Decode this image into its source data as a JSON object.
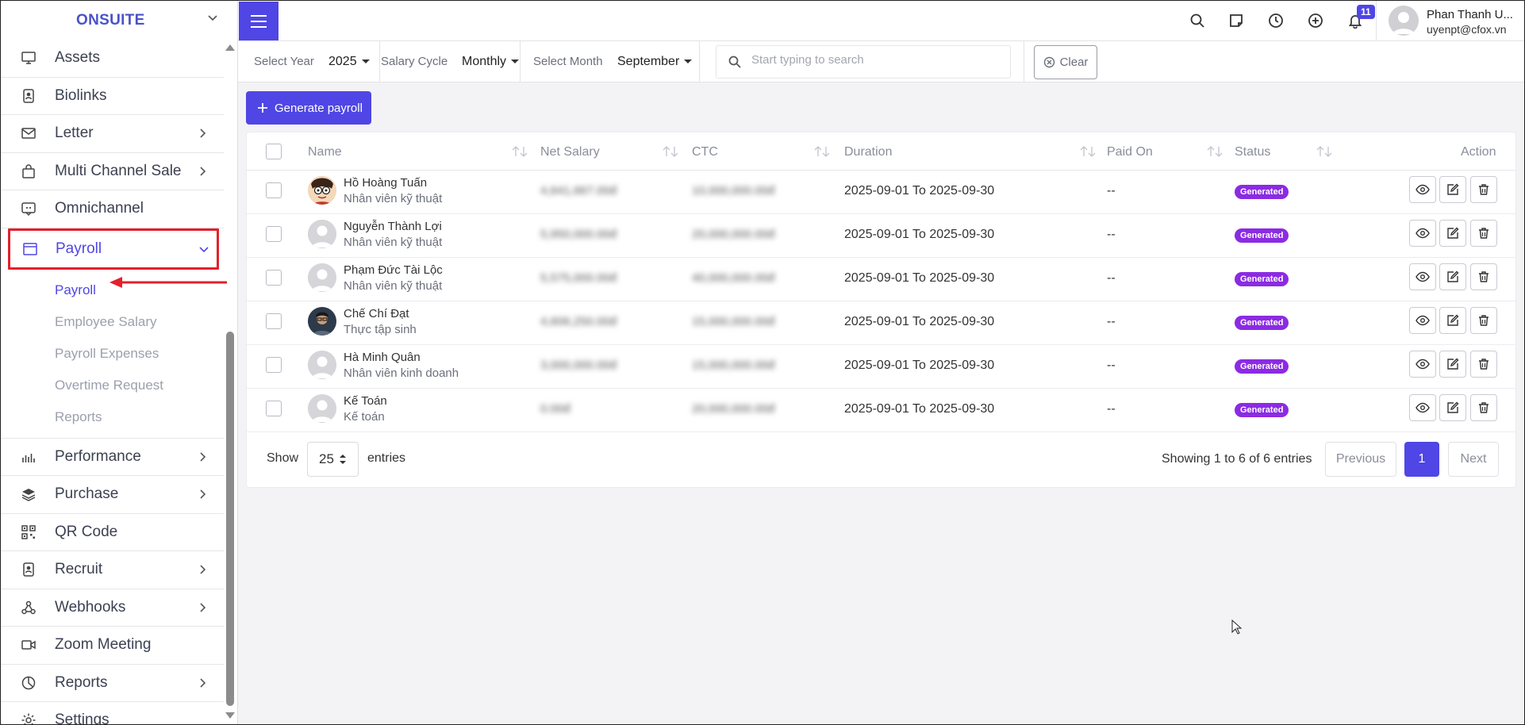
{
  "sidebar": {
    "brand": "ONSUITE",
    "items": [
      {
        "label": "Assets",
        "icon": "monitor-icon"
      },
      {
        "label": "Biolinks",
        "icon": "id-badge-icon"
      },
      {
        "label": "Letter",
        "icon": "mail-icon"
      },
      {
        "label": "Multi Channel Sale",
        "icon": "shopping-bag-icon"
      },
      {
        "label": "Omnichannel",
        "icon": "chat-icon"
      },
      {
        "label": "Payroll",
        "icon": "browser-window-icon"
      },
      {
        "label": "Performance",
        "icon": "bar-chart-icon"
      },
      {
        "label": "Purchase",
        "icon": "layers-icon"
      },
      {
        "label": "QR Code",
        "icon": "qr-code-icon"
      },
      {
        "label": "Recruit",
        "icon": "id-card-icon"
      },
      {
        "label": "Webhooks",
        "icon": "webhook-icon"
      },
      {
        "label": "Zoom Meeting",
        "icon": "video-icon"
      },
      {
        "label": "Reports",
        "icon": "pie-chart-icon"
      },
      {
        "label": "Settings",
        "icon": "gear-icon"
      }
    ],
    "payroll_sub": [
      "Payroll",
      "Employee Salary",
      "Payroll Expenses",
      "Overtime Request",
      "Reports"
    ]
  },
  "topbar": {
    "notification_count": "11",
    "user_name": "Phan Thanh U...",
    "user_email": "uyenpt@cfox.vn"
  },
  "filters": {
    "year_label": "Select Year",
    "year_value": "2025",
    "cycle_label": "Salary Cycle",
    "cycle_value": "Monthly",
    "month_label": "Select Month",
    "month_value": "September",
    "search_placeholder": "Start typing to search",
    "clear_label": "Clear"
  },
  "generate_label": "Generate payroll",
  "table": {
    "headers": {
      "name": "Name",
      "net": "Net Salary",
      "ctc": "CTC",
      "duration": "Duration",
      "paid": "Paid On",
      "status": "Status",
      "action": "Action"
    },
    "rows": [
      {
        "name": "Hồ Hoàng Tuấn",
        "role": "Nhân viên kỹ thuật",
        "net": "4,641,667.00đ",
        "ctc": "10,000,000.00đ",
        "duration": "2025-09-01 To 2025-09-30",
        "paid": "--",
        "status": "Generated",
        "avatar": "cartoon"
      },
      {
        "name": "Nguyễn Thành Lợi",
        "role": "Nhân viên kỹ thuật",
        "net": "5,950,000.00đ",
        "ctc": "20,000,000.00đ",
        "duration": "2025-09-01 To 2025-09-30",
        "paid": "--",
        "status": "Generated",
        "avatar": "default"
      },
      {
        "name": "Phạm Đức Tài Lộc",
        "role": "Nhân viên kỹ thuật",
        "net": "5,575,000.00đ",
        "ctc": "40,000,000.00đ",
        "duration": "2025-09-01 To 2025-09-30",
        "paid": "--",
        "status": "Generated",
        "avatar": "default"
      },
      {
        "name": "Chế Chí Đạt",
        "role": "Thực tập sinh",
        "net": "4,606,250.00đ",
        "ctc": "15,000,000.00đ",
        "duration": "2025-09-01 To 2025-09-30",
        "paid": "--",
        "status": "Generated",
        "avatar": "photo"
      },
      {
        "name": "Hà Minh Quân",
        "role": "Nhân viên kinh doanh",
        "net": "3,000,000.00đ",
        "ctc": "15,000,000.00đ",
        "duration": "2025-09-01 To 2025-09-30",
        "paid": "--",
        "status": "Generated",
        "avatar": "default"
      },
      {
        "name": "Kế Toán",
        "role": "Kế toán",
        "net": "0.00đ",
        "ctc": "20,000,000.00đ",
        "duration": "2025-09-01 To 2025-09-30",
        "paid": "--",
        "status": "Generated",
        "avatar": "default"
      }
    ]
  },
  "footer": {
    "show_label": "Show",
    "entries_value": "25",
    "entries_label": "entries",
    "showing_text": "Showing 1 to 6 of 6 entries",
    "previous": "Previous",
    "page": "1",
    "next": "Next"
  },
  "colors": {
    "accent": "#4f46e5",
    "status": "#8b2be2",
    "highlight": "#e3202b"
  }
}
